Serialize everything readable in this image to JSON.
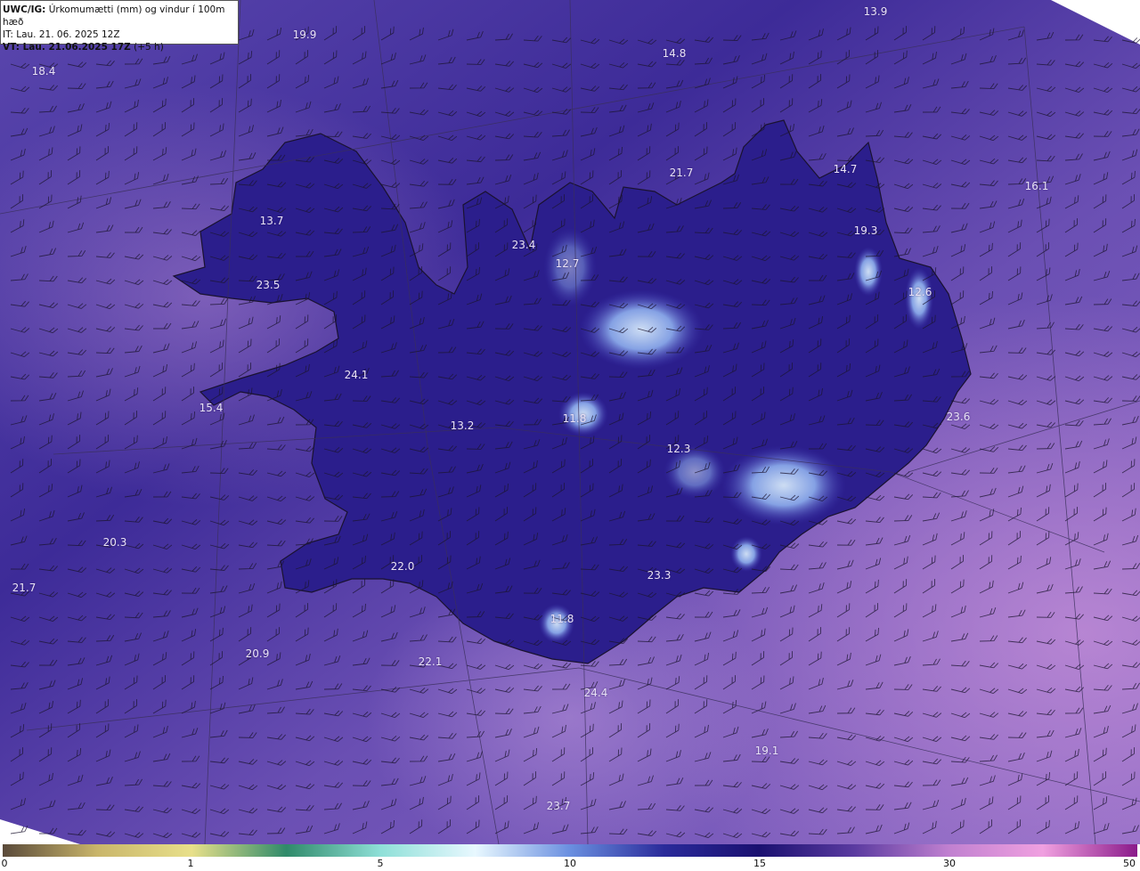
{
  "header": {
    "model": "UWC/IG:",
    "title": "Úrkomumætti (mm) og vindur í 100m hæð",
    "it": "IT: Lau. 21. 06. 2025 12Z",
    "vt_bold": "VT: Lau. 21.06.2025 17Z",
    "vt_rest": "(+5 h)"
  },
  "map": {
    "background_color": "#4e3a9e",
    "land_color": "#2a1d86",
    "coast_color": "#1a1230"
  },
  "values": [
    {
      "id": "v01",
      "text": "13.9"
    },
    {
      "id": "v02",
      "text": "19.9"
    },
    {
      "id": "v03",
      "text": "18.4"
    },
    {
      "id": "v04",
      "text": "14.8"
    },
    {
      "id": "v05",
      "text": "21.7"
    },
    {
      "id": "v06",
      "text": "14.7"
    },
    {
      "id": "v07",
      "text": "16.1"
    },
    {
      "id": "v08",
      "text": "13.7"
    },
    {
      "id": "v09",
      "text": "23.4"
    },
    {
      "id": "v10",
      "text": "12.7"
    },
    {
      "id": "v11",
      "text": "19.3"
    },
    {
      "id": "v12",
      "text": "23.5"
    },
    {
      "id": "v13",
      "text": "12.6"
    },
    {
      "id": "v14",
      "text": "24.1"
    },
    {
      "id": "v15",
      "text": "15.4"
    },
    {
      "id": "v16",
      "text": "13.2"
    },
    {
      "id": "v17",
      "text": "11.8"
    },
    {
      "id": "v18",
      "text": "23.6"
    },
    {
      "id": "v19",
      "text": "12.3"
    },
    {
      "id": "v20",
      "text": "20.3"
    },
    {
      "id": "v21",
      "text": "22.0"
    },
    {
      "id": "v22",
      "text": "21.7"
    },
    {
      "id": "v23",
      "text": "23.3"
    },
    {
      "id": "v24",
      "text": "11.8"
    },
    {
      "id": "v25",
      "text": "20.9"
    },
    {
      "id": "v26",
      "text": "22.1"
    },
    {
      "id": "v27",
      "text": "24.4"
    },
    {
      "id": "v28",
      "text": "19.1"
    },
    {
      "id": "v29",
      "text": "23.7"
    }
  ],
  "colorbar": {
    "ticks": [
      "0",
      "1",
      "5",
      "10",
      "15",
      "30",
      "50"
    ],
    "colors": [
      "#5a4a3a",
      "#c9b56a",
      "#e8e08a",
      "#2f8a6a",
      "#8fe0d8",
      "#e8f8ff",
      "#6a8fe0",
      "#2a2a9a",
      "#1a1070",
      "#5a3aa0",
      "#c080d0",
      "#f0a0e0",
      "#8a1a8a"
    ]
  }
}
